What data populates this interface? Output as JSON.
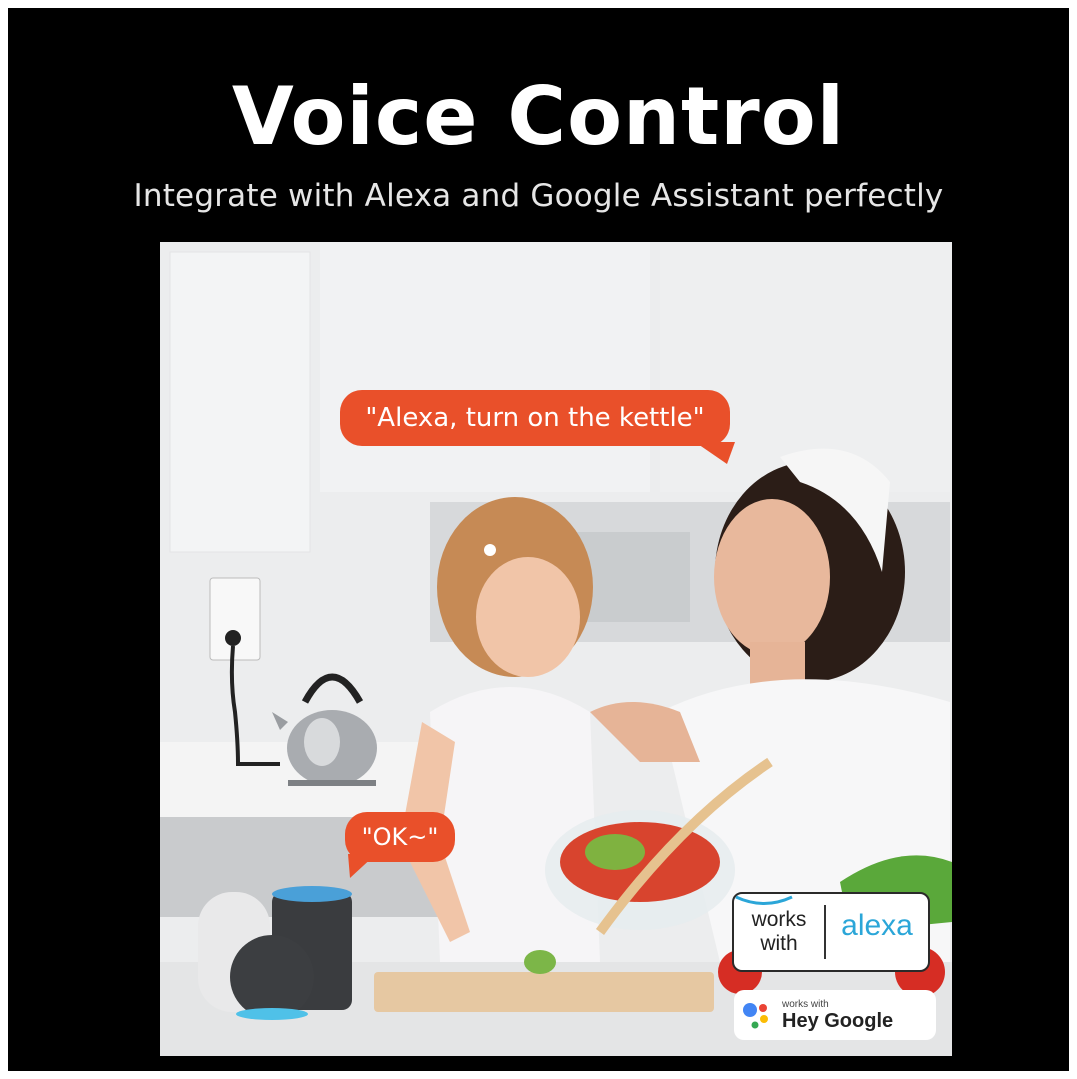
{
  "header": {
    "title": "Voice Control",
    "subtitle": "Integrate with Alexa and Google Assistant perfectly"
  },
  "photo": {
    "description_icons": [
      "wall-outlet-icon",
      "kettle-icon",
      "smart-speaker-icon"
    ],
    "bubbles": {
      "alexa_command": "\"Alexa, turn on the kettle\"",
      "ok_reply": "\"OK~\""
    },
    "badges": {
      "alexa_works": "works with",
      "alexa_brand": "alexa",
      "google_small": "works with",
      "google_big": "Hey Google"
    }
  },
  "colors": {
    "background": "#000000",
    "bubble": "#e9502a",
    "alexa_blue": "#2ba6d8"
  }
}
